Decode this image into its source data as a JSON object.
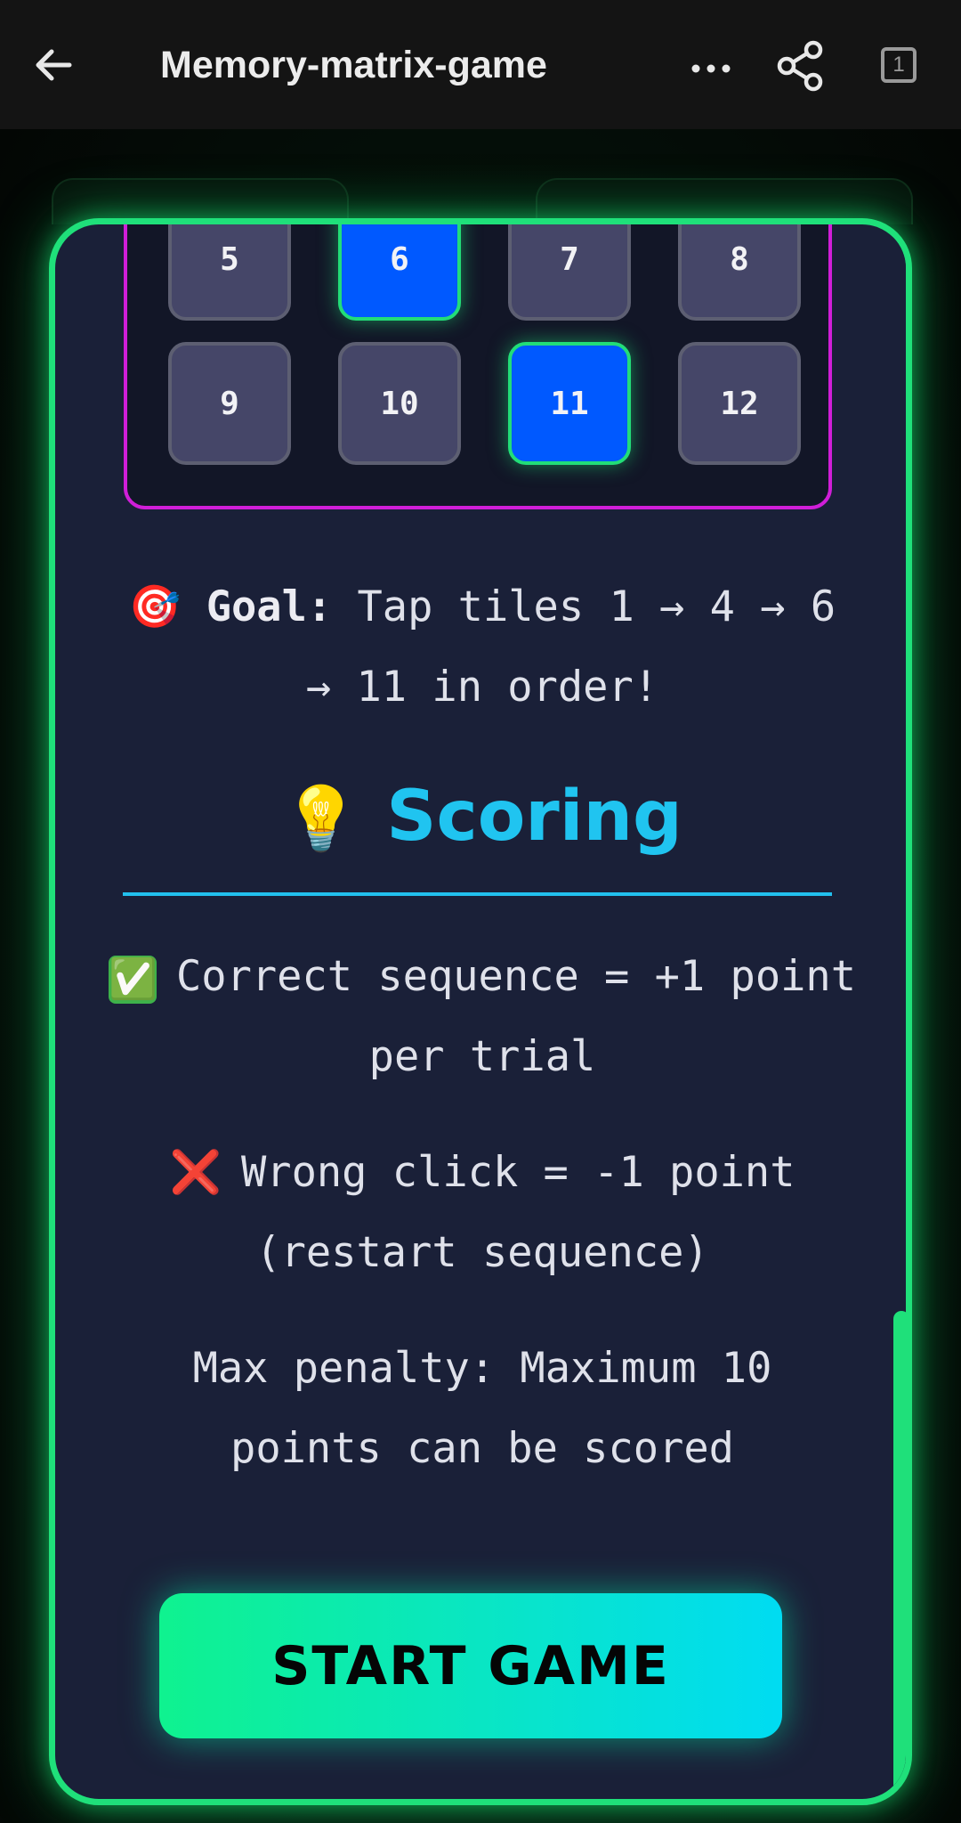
{
  "header": {
    "title": "Memory-matrix-game",
    "tab_count": "1",
    "icons": {
      "back": "arrow-left-icon",
      "more": "more-horizontal-icon",
      "share": "share-icon",
      "tabs": "tabs-icon"
    }
  },
  "grid": {
    "tiles": [
      {
        "label": "5",
        "active": false
      },
      {
        "label": "6",
        "active": true
      },
      {
        "label": "7",
        "active": false
      },
      {
        "label": "8",
        "active": false
      },
      {
        "label": "9",
        "active": false
      },
      {
        "label": "10",
        "active": false
      },
      {
        "label": "11",
        "active": true
      },
      {
        "label": "12",
        "active": false
      }
    ]
  },
  "goal": {
    "emoji": "🎯",
    "label": "Goal:",
    "text": " Tap tiles 1 → 4 → 6 → 11 in order!"
  },
  "scoring": {
    "emoji": "💡",
    "title": "Scoring",
    "rules": [
      {
        "emoji": "✅",
        "text": "Correct sequence = +1 point per trial"
      },
      {
        "emoji": "❌",
        "text": "Wrong click = -1 point (restart sequence)"
      },
      {
        "emoji": "",
        "text": "Max penalty: Maximum 10 points can be scored"
      }
    ]
  },
  "start_button": {
    "label": "START GAME"
  },
  "colors": {
    "accent_green": "#1fe07a",
    "accent_cyan": "#20c4f0",
    "tile_active": "#0059ff",
    "grid_border": "#d01ed8",
    "card_bg": "#1a2038"
  }
}
